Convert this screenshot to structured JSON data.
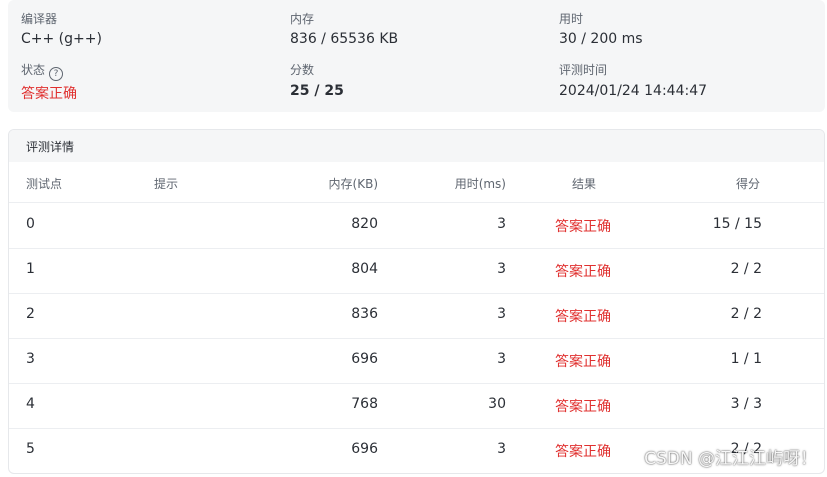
{
  "summary": {
    "compiler_label": "编译器",
    "compiler_value": "C++ (g++)",
    "memory_label": "内存",
    "memory_value": "836 / 65536 KB",
    "time_label": "用时",
    "time_value": "30 / 200 ms",
    "status_label": "状态",
    "status_help_icon": "question-circle-icon",
    "status_value": "答案正确",
    "score_label": "分数",
    "score_value": "25 / 25",
    "judge_time_label": "评测时间",
    "judge_time_value": "2024/01/24 14:44:47"
  },
  "details": {
    "title": "评测详情",
    "columns": {
      "test_point": "测试点",
      "hint": "提示",
      "memory": "内存(KB)",
      "time": "用时(ms)",
      "result": "结果",
      "score": "得分"
    },
    "rows": [
      {
        "id": "0",
        "hint": "",
        "memory": "820",
        "time": "3",
        "result": "答案正确",
        "score": "15 / 15"
      },
      {
        "id": "1",
        "hint": "",
        "memory": "804",
        "time": "3",
        "result": "答案正确",
        "score": "2 / 2"
      },
      {
        "id": "2",
        "hint": "",
        "memory": "836",
        "time": "3",
        "result": "答案正确",
        "score": "2 / 2"
      },
      {
        "id": "3",
        "hint": "",
        "memory": "696",
        "time": "3",
        "result": "答案正确",
        "score": "1 / 1"
      },
      {
        "id": "4",
        "hint": "",
        "memory": "768",
        "time": "30",
        "result": "答案正确",
        "score": "3 / 3"
      },
      {
        "id": "5",
        "hint": "",
        "memory": "696",
        "time": "3",
        "result": "答案正确",
        "score": "2 / 2"
      }
    ]
  },
  "watermark": "CSDN @江江江屿呀！",
  "colors": {
    "accept": "#e0302f",
    "panel_bg": "#f5f6f7"
  }
}
